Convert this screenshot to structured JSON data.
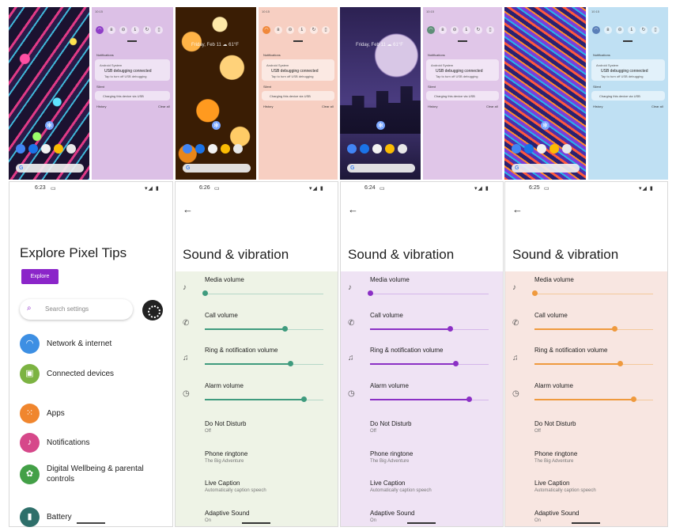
{
  "top_row": {
    "lock_clock": "Friday, Feb 11 ☁ 61°F",
    "shade_status_time": "10:15",
    "shade_status_icons": "▾◢ ▮",
    "notifications_header": "Notifications",
    "app_name": "Android System",
    "usb_title": "USB debugging connected",
    "usb_sub": "Tap to turn off USB debugging",
    "silent_header": "Silent",
    "charging_text": "Charging this device via USB",
    "history_label": "History",
    "clear_all_label": "Clear all",
    "themes": [
      {
        "accent": "#8e3dc7",
        "shade_bg": "#dcc0e6"
      },
      {
        "accent": "#f0883a",
        "shade_bg": "#f7cfc2"
      },
      {
        "accent": "#5e8e78",
        "shade_bg": "#e0c6e8"
      },
      {
        "accent": "#5a7fb8",
        "shade_bg": "#bfe0f3"
      }
    ]
  },
  "settings_home": {
    "time": "6:23",
    "status_icons": "▾◢ ▮",
    "title": "Explore Pixel Tips",
    "explore_button": "Explore",
    "search_placeholder": "Search settings",
    "items": [
      {
        "label": "Network & internet",
        "icon": "wifi-icon",
        "color": "#3d8fe3",
        "glyph": "◠"
      },
      {
        "label": "Connected devices",
        "icon": "devices-icon",
        "color": "#7cb342",
        "glyph": "▣"
      },
      {
        "label": "Apps",
        "icon": "apps-icon",
        "color": "#f0862e",
        "glyph": "⁙"
      },
      {
        "label": "Notifications",
        "icon": "bell-icon",
        "color": "#d6488a",
        "glyph": "♪"
      },
      {
        "label": "Digital Wellbeing & parental controls",
        "icon": "wellbeing-icon",
        "color": "#43a047",
        "glyph": "✿"
      },
      {
        "label": "Battery",
        "icon": "battery-icon",
        "color": "#2e6f6a",
        "glyph": "▮"
      }
    ]
  },
  "sound_panels": [
    {
      "time": "6:26",
      "accent": "#3f9b7e",
      "track": "#b5d7c8",
      "body_bg": "#eef3e6"
    },
    {
      "time": "6:24",
      "accent": "#8b30c5",
      "track": "#d4b6ea",
      "body_bg": "#efe3f4"
    },
    {
      "time": "6:25",
      "accent": "#ef9a3e",
      "track": "#f4c99b",
      "body_bg": "#f8e6e1"
    }
  ],
  "sound_common": {
    "status_icons": "▾◢ ▮",
    "back_arrow": "←",
    "title": "Sound & vibration",
    "volumes": [
      {
        "label": "Media volume",
        "icon": "music-note-icon",
        "glyph": "♪",
        "level": 0.0
      },
      {
        "label": "Call volume",
        "icon": "phone-icon",
        "glyph": "✆",
        "level": 0.67
      },
      {
        "label": "Ring & notification volume",
        "icon": "bell-icon",
        "glyph": "♫",
        "level": 0.72
      },
      {
        "label": "Alarm volume",
        "icon": "alarm-icon",
        "glyph": "◷",
        "level": 0.83
      }
    ],
    "items": [
      {
        "title": "Do Not Disturb",
        "subtitle": "Off"
      },
      {
        "title": "Phone ringtone",
        "subtitle": "The Big Adventure"
      },
      {
        "title": "Live Caption",
        "subtitle": "Automatically caption speech"
      },
      {
        "title": "Adaptive Sound",
        "subtitle": "On"
      }
    ]
  }
}
